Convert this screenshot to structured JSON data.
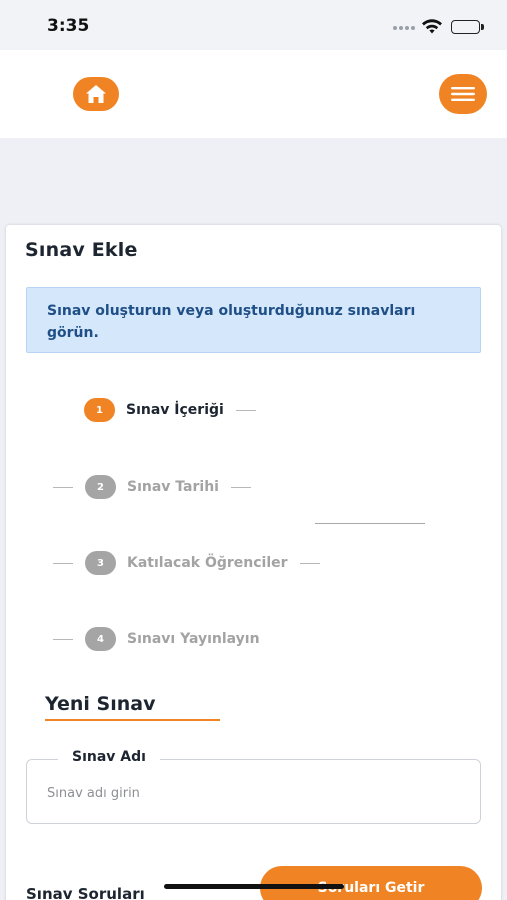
{
  "status_bar": {
    "time": "3:35"
  },
  "header": {
    "home_icon": "home-icon",
    "menu_icon": "hamburger-menu-icon",
    "accent_color": "#f08323"
  },
  "card": {
    "title": "Sınav Ekle",
    "info_text": "Sınav oluşturun veya oluşturduğunuz sınavları görün."
  },
  "steps": [
    {
      "number": "1",
      "label": "Sınav İçeriği",
      "active": true
    },
    {
      "number": "2",
      "label": "Sınav Tarihi",
      "active": false
    },
    {
      "number": "3",
      "label": "Katılacak Öğrenciler",
      "active": false
    },
    {
      "number": "4",
      "label": "Sınavı Yayınlayın",
      "active": false
    }
  ],
  "new_exam": {
    "title": "Yeni Sınav",
    "name_field": {
      "label": "Sınav Adı",
      "placeholder": "Sınav adı girin",
      "value": ""
    },
    "questions_label": "Sınav Soruları",
    "fetch_button": "Soruları Getir"
  }
}
